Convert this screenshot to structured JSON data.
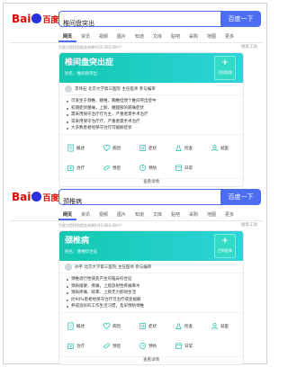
{
  "colors": {
    "accent": "#4e6ef2",
    "card_gradient_start": "#12c9b0",
    "card_gradient_end": "#2ed3d9",
    "logo_red": "#e10602",
    "logo_blue": "#2932e1"
  },
  "logo": {
    "text_left": "Bai",
    "text_right": "百度"
  },
  "results": [
    {
      "query": "椎间盘突出",
      "search_button": "百度一下",
      "tabs": [
        "网页",
        "资讯",
        "视频",
        "图片",
        "知道",
        "文库",
        "贴吧",
        "采购",
        "地图",
        "更多"
      ],
      "count_text": "百度为您找到相关结果约35,400,000个",
      "tool_label": "搜索工具",
      "card": {
        "title": "椎间盘突出症",
        "subtitle": "别名：椎间盘突出",
        "encyclopedia_label": "百科医典",
        "doctor": "李伟石  北京大学第三医院  主任医师  参与编审",
        "bullets": [
          "可发生于颈椎、腰椎、胸椎但颈个椎间突出症中",
          "初期症状腰痛，上肢、腰腿部的麻痛症状",
          "需采用保守治疗疗为主，严重者需手术治疗",
          "常采用保守治疗疗，严重者需手术治疗",
          "大多数患者经保守治疗可缓解症状"
        ],
        "grid": [
          {
            "icon": "document-icon",
            "label": "概述"
          },
          {
            "icon": "heartbeat-icon",
            "label": "病因"
          },
          {
            "icon": "stethoscope-icon",
            "label": "症状"
          },
          {
            "icon": "flask-icon",
            "label": "检查"
          },
          {
            "icon": "doctor-icon",
            "label": "就医"
          },
          {
            "icon": "medkit-icon",
            "label": "治疗"
          },
          {
            "icon": "pill-icon",
            "label": "预后"
          },
          {
            "icon": "clock-icon",
            "label": "预防"
          },
          {
            "icon": "calendar-icon",
            "label": "日常"
          }
        ],
        "more_label": "查看详情"
      }
    },
    {
      "query": "颈椎病",
      "search_button": "百度一下",
      "tabs": [
        "网页",
        "资讯",
        "视频",
        "图片",
        "知道",
        "文库",
        "贴吧",
        "采购",
        "地图",
        "更多"
      ],
      "count_text": "百度为您找到相关结果约43,800,000个",
      "tool_label": "搜索工具",
      "card": {
        "title": "颈椎病",
        "subtitle": "别名：颈椎综合征",
        "encyclopedia_label": "百科医典",
        "doctor": "孙宇  北京大学第三医院  主任医师  参与编审",
        "bullets": [
          "颈椎退行性病变产生的临床综合征",
          "颈肩僵硬、疼痛，上肢放射性疼痛麻木",
          "颈肩疼痛、眩晕、上肢无力影响生活",
          "约90%患者经保守治疗可治疗病变缓解",
          "养成良好的工作生活习惯，及早预防颈椎"
        ],
        "grid": [
          {
            "icon": "document-icon",
            "label": "概述"
          },
          {
            "icon": "heartbeat-icon",
            "label": "病因"
          },
          {
            "icon": "stethoscope-icon",
            "label": "症状"
          },
          {
            "icon": "flask-icon",
            "label": "检查"
          },
          {
            "icon": "doctor-icon",
            "label": "就医"
          },
          {
            "icon": "medkit-icon",
            "label": "治疗"
          },
          {
            "icon": "pill-icon",
            "label": "预后"
          },
          {
            "icon": "clock-icon",
            "label": "预防"
          },
          {
            "icon": "calendar-icon",
            "label": "日常"
          }
        ],
        "more_label": "查看详情"
      }
    }
  ]
}
